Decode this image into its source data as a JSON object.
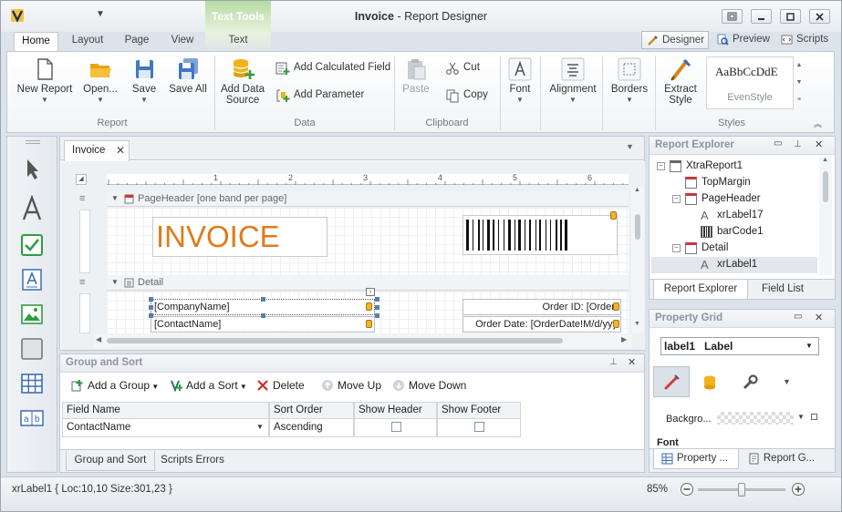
{
  "window": {
    "title_doc": "Invoice",
    "title_sep": " - ",
    "title_app": "Report Designer",
    "context_group": "Text Tools"
  },
  "tabs": [
    {
      "label": "Home",
      "active": true
    },
    {
      "label": "Layout"
    },
    {
      "label": "Page"
    },
    {
      "label": "View"
    },
    {
      "label": "Text"
    }
  ],
  "view_tabs": [
    {
      "label": "Designer",
      "active": true,
      "icon": "designer-icon"
    },
    {
      "label": "Preview",
      "icon": "preview-icon"
    },
    {
      "label": "Scripts",
      "icon": "scripts-icon"
    }
  ],
  "ribbon": {
    "report": {
      "group_label": "Report",
      "new_report": "New Report",
      "open": "Open...",
      "save": "Save",
      "save_all": "Save All"
    },
    "data": {
      "group_label": "Data",
      "add_data_source_1": "Add Data",
      "add_data_source_2": "Source",
      "add_calculated_field": "Add Calculated Field",
      "add_parameter": "Add Parameter"
    },
    "clipboard": {
      "group_label": "Clipboard",
      "paste": "Paste",
      "cut": "Cut",
      "copy": "Copy"
    },
    "formatting": {
      "font": "Font",
      "alignment": "Alignment",
      "borders": "Borders"
    },
    "styles": {
      "group_label": "Styles",
      "extract_style_1": "Extract",
      "extract_style_2": "Style",
      "preview_text": "AaBbCcDdE",
      "style_name": "EvenStyle"
    }
  },
  "document": {
    "tab_label": "Invoice",
    "page_header_band": "PageHeader [one band per page]",
    "detail_band": "Detail",
    "invoice_title": "INVOICE",
    "company_name_field": "[CompanyName]",
    "contact_name_field": "[ContactName]",
    "order_id_field": "Order ID: [OrderI",
    "order_date_field": "Order Date: [OrderDate!M/d/yyy",
    "ruler_marks": [
      "1",
      "2",
      "3",
      "4",
      "5",
      "6"
    ],
    "colors": {
      "invoice_title": "#e07b1c"
    }
  },
  "group_sort": {
    "title": "Group and Sort",
    "add_group": "Add a Group",
    "add_sort": "Add a Sort",
    "delete": "Delete",
    "move_up": "Move Up",
    "move_down": "Move Down",
    "columns": [
      "Field Name",
      "Sort Order",
      "Show Header",
      "Show Footer"
    ],
    "rows": [
      {
        "field_name": "ContactName",
        "sort_order": "Ascending",
        "show_header": false,
        "show_footer": false
      }
    ],
    "bottom_tabs": [
      {
        "label": "Group and Sort",
        "active": true
      },
      {
        "label": "Scripts Errors"
      }
    ]
  },
  "report_explorer": {
    "title": "Report Explorer",
    "tree": [
      {
        "label": "XtraReport1",
        "level": 0,
        "expander": "minus",
        "icon": "report-icon"
      },
      {
        "label": "TopMargin",
        "level": 1,
        "icon": "band-icon"
      },
      {
        "label": "PageHeader",
        "level": 1,
        "expander": "minus",
        "icon": "band-icon"
      },
      {
        "label": "xrLabel17",
        "level": 2,
        "icon": "label-icon"
      },
      {
        "label": "barCode1",
        "level": 2,
        "icon": "barcode-icon"
      },
      {
        "label": "Detail",
        "level": 1,
        "expander": "minus",
        "icon": "band-icon"
      },
      {
        "label": "xrLabel1",
        "level": 2,
        "icon": "label-icon",
        "selected": true
      }
    ],
    "tabs": [
      {
        "label": "Report Explorer",
        "active": true
      },
      {
        "label": "Field List"
      }
    ]
  },
  "property_grid": {
    "title": "Property Grid",
    "selected_object_name": "label1",
    "selected_object_type": "Label",
    "background_label": "Backgro...",
    "font_category": "Font",
    "tabs": [
      {
        "label": "Property ...",
        "icon": "property-grid-icon"
      },
      {
        "label": "Report G...",
        "icon": "report-gallery-icon"
      }
    ]
  },
  "status": {
    "selection_info": "xrLabel1 { Loc:10,10 Size:301,23 }",
    "zoom": "85%",
    "zoom_level": 0.5
  }
}
